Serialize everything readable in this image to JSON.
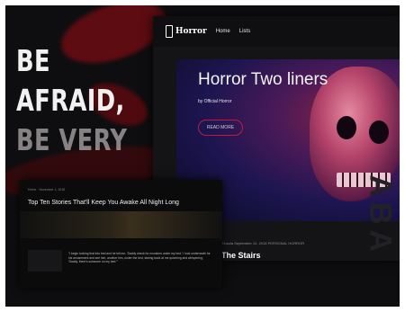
{
  "headline": {
    "line1": "BE",
    "line2": "AFRAID,",
    "line3": "BE VERY"
  },
  "site": {
    "logo": "Horror",
    "nav": [
      "Home",
      "Lists"
    ],
    "hero": {
      "title": "Horror Two liners",
      "byline": "by Official Horror",
      "button": "READ MORE"
    },
    "post": {
      "meta": "Tfusola   September 10, 2018  PERSONAL HORROR",
      "title": "The Stairs"
    },
    "background_letters": "ABA"
  },
  "article": {
    "breadcrumb": "Home  ·  November 1, 2018",
    "title": "Top Ten Stories That'll Keep You Awake All Night Long",
    "excerpt": "\"I begin tucking that into bed and he tell me, 'Daddy check for monsters under my bed.' I look underneath for his amusement and see him, another him, under the bed, staring back at me quivering and whispering, 'Daddy, there's someone on my bed.'\""
  },
  "colors": {
    "accent": "#c21a3a",
    "background": "#0e0e10",
    "brush": "#6b0c12"
  }
}
